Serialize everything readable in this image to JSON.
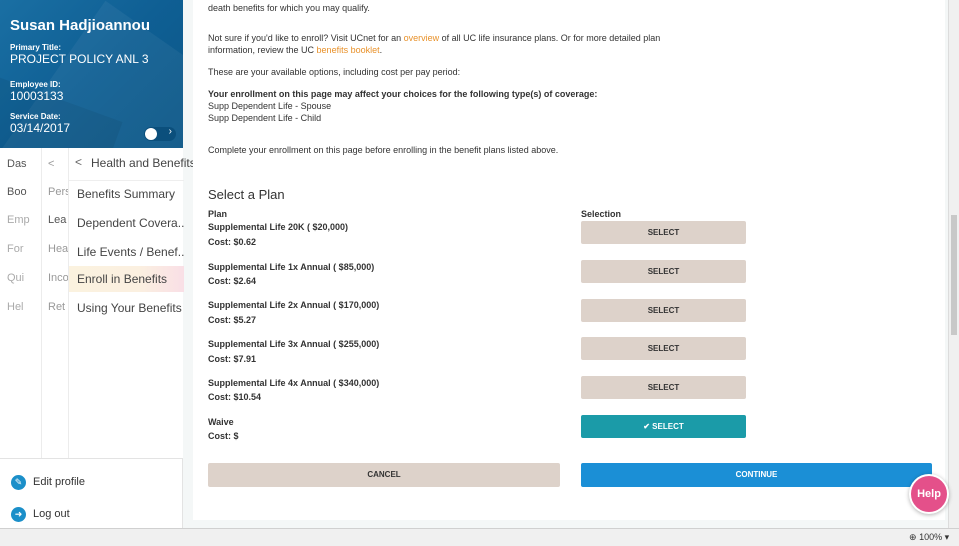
{
  "profile": {
    "name": "Susan Hadjioannou",
    "primary_title_label": "Primary Title:",
    "primary_title": "PROJECT POLICY ANL 3",
    "employee_id_label": "Employee ID:",
    "employee_id": "10003133",
    "service_date_label": "Service Date:",
    "service_date": "03/14/2017"
  },
  "nav": {
    "col1": [
      "Das",
      "Boo",
      "Emp",
      "For",
      "Qui",
      "Hel"
    ],
    "col2_back": "<",
    "col2": [
      "Pers",
      "Lea",
      "Hea",
      "Inco",
      "Ret"
    ],
    "col3_back": "<",
    "col3_title": "Health and Benefits",
    "col3": [
      "Benefits Summary",
      "Dependent Covera...",
      "Life Events / Benef...",
      "Enroll in Benefits",
      "Using Your Benefits"
    ]
  },
  "footer_links": {
    "edit_profile": "Edit profile",
    "log_out": "Log out"
  },
  "content": {
    "line_top": "death benefits for which you may qualify.",
    "enroll_q_1": "Not sure if you'd like to enroll? Visit UCnet for an ",
    "enroll_q_link": "overview",
    "enroll_q_2": " of all UC life insurance plans. Or for more detailed plan",
    "enroll_q_3": "information, review the UC ",
    "enroll_q_link2": "benefits booklet",
    "enroll_q_4": ".",
    "options_text": "These are your available options, including cost per pay period:",
    "affect_text": "Your enrollment on this page may affect your choices for the following type(s) of coverage:",
    "affect_1": "Supp Dependent Life - Spouse",
    "affect_2": "Supp Dependent Life - Child",
    "complete_text": "Complete your enrollment on this page before enrolling in the benefit plans listed above.",
    "section_title": "Select a Plan",
    "col_plan": "Plan",
    "col_selection": "Selection"
  },
  "plans": [
    {
      "name": "Supplemental Life 20K ( $20,000)",
      "cost": "Cost: $0.62",
      "button": "SELECT"
    },
    {
      "name": "Supplemental Life 1x Annual ( $85,000)",
      "cost": "Cost: $2.64",
      "button": "SELECT"
    },
    {
      "name": "Supplemental Life 2x Annual ( $170,000)",
      "cost": "Cost: $5.27",
      "button": "SELECT"
    },
    {
      "name": "Supplemental Life 3x Annual ( $255,000)",
      "cost": "Cost: $7.91",
      "button": "SELECT"
    },
    {
      "name": "Supplemental Life 4x Annual ( $340,000)",
      "cost": "Cost: $10.54",
      "button": "SELECT"
    },
    {
      "name": "Waive",
      "cost": "Cost: $",
      "button": "✔ SELECT"
    }
  ],
  "selected_plan": "Waive",
  "actions": {
    "cancel": "CANCEL",
    "continue": "CONTINUE"
  },
  "help": "Help",
  "zoom": "100%",
  "colors": {
    "profile_bg": "#0f5f94",
    "select_bg": "#ddd2ca",
    "selected_bg": "#1b9ba8",
    "continue_bg": "#1b8fd6",
    "link": "#e8912a",
    "help_bg": "#e4508a",
    "active_nav": "#fbf2df"
  },
  "icons": {
    "edit_profile": "pencil-icon",
    "log_out": "logout-icon",
    "zoom": "magnifier-icon"
  }
}
